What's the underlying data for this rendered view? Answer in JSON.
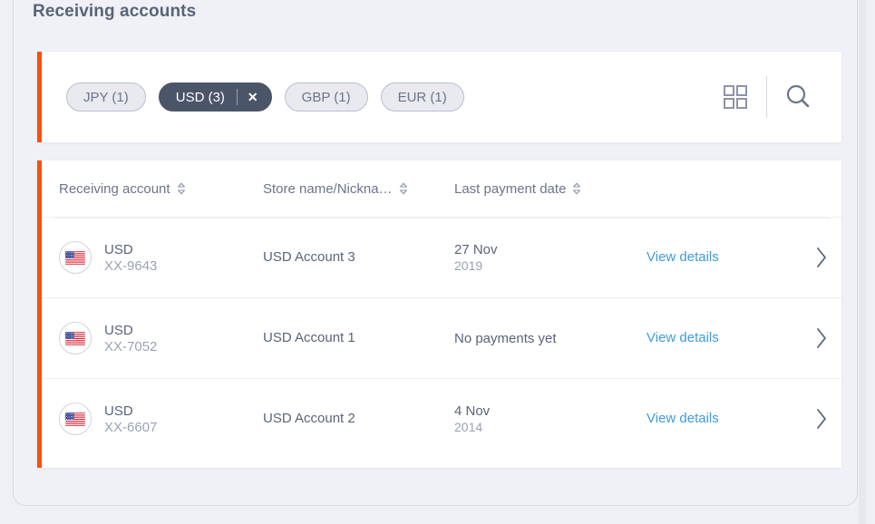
{
  "page": {
    "title": "Receiving accounts",
    "accent_color": "#f9500b",
    "link_color": "#3d9ae2",
    "selected_chip_bg": "#4a5568"
  },
  "filters": {
    "chips": [
      {
        "label": "JPY (1)",
        "selected": false
      },
      {
        "label": "USD (3)",
        "selected": true,
        "close_label": "✕"
      },
      {
        "label": "GBP (1)",
        "selected": false
      },
      {
        "label": "EUR (1)",
        "selected": false
      }
    ],
    "grid_view_icon": "grid-view-icon",
    "search_icon": "search-icon"
  },
  "table": {
    "columns": [
      {
        "label": "Receiving account",
        "sortable": true
      },
      {
        "label": "Store name/Nickna…",
        "sortable": true
      },
      {
        "label": "Last payment date",
        "sortable": true
      }
    ],
    "rows": [
      {
        "flag": "us-flag-icon",
        "currency": "USD",
        "account_number": "XX-9643",
        "store_name": "USD Account 3",
        "date_main": "27 Nov",
        "date_year": "2019",
        "link_label": "View details",
        "chevron": "chevron-right-icon"
      },
      {
        "flag": "us-flag-icon",
        "currency": "USD",
        "account_number": "XX-7052",
        "store_name": "USD Account 1",
        "date_main": "No payments yet",
        "date_year": "",
        "link_label": "View details",
        "chevron": "chevron-right-icon"
      },
      {
        "flag": "us-flag-icon",
        "currency": "USD",
        "account_number": "XX-6607",
        "store_name": "USD Account 2",
        "date_main": "4 Nov",
        "date_year": "2014",
        "link_label": "View details",
        "chevron": "chevron-right-icon"
      }
    ]
  }
}
